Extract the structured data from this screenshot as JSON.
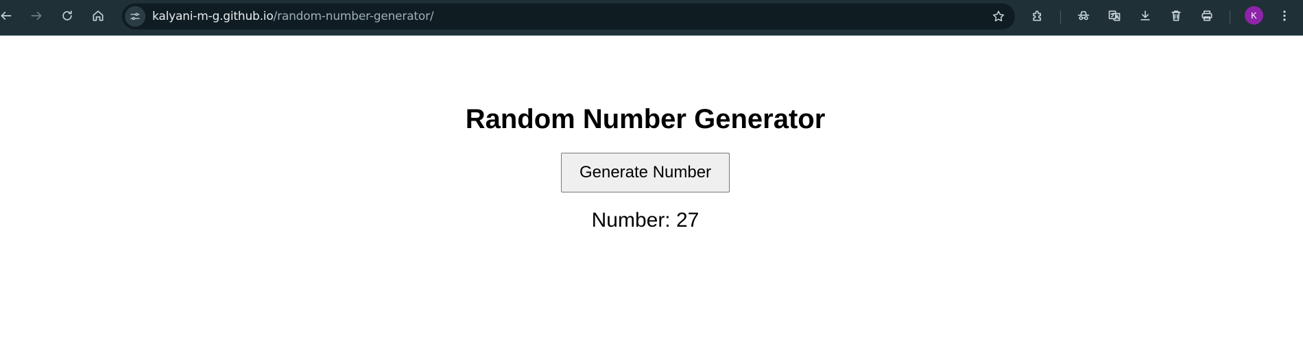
{
  "browser": {
    "url_host": "kalyani-m-g.github.io",
    "url_path": "/random-number-generator/",
    "profile_initial": "K",
    "colors": {
      "toolbar_bg": "#1f3036",
      "omnibox_bg": "#0f1c21",
      "avatar": "#8e24aa"
    },
    "icons": [
      "back-icon",
      "forward-icon",
      "reload-icon",
      "home-icon",
      "site-info-icon",
      "bookmark-star-icon",
      "extensions-icon",
      "incognito-icon",
      "translate-icon",
      "download-icon",
      "delete-icon",
      "print-icon",
      "menu-icon"
    ]
  },
  "page": {
    "title": "Random Number Generator",
    "button_label": "Generate Number",
    "result_label": "Number:",
    "result_value": "27"
  }
}
